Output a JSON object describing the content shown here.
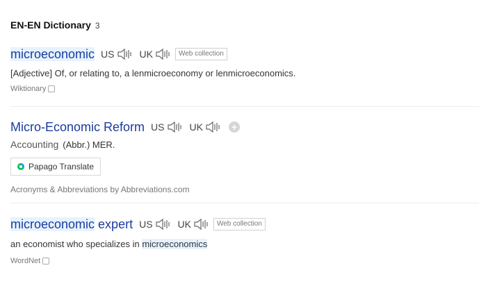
{
  "header": {
    "title": "EN-EN Dictionary",
    "count": "3"
  },
  "entries": [
    {
      "term": "microeconomic",
      "us_label": "US",
      "uk_label": "UK",
      "tag": "Web collection",
      "pos": "[Adjective]",
      "definition": " Of, or relating to, a lenmicroeconomy or lenmicroeconomics.",
      "source": "Wiktionary"
    },
    {
      "term": "Micro-Economic Reform",
      "us_label": "US",
      "uk_label": "UK",
      "category": "Accounting",
      "definition": "(Abbr.) MER.",
      "translate_button": "Papago Translate",
      "source": "Acronyms & Abbreviations by Abbreviations.com"
    },
    {
      "term_part1": "microeconomic",
      "term_part2": " expert",
      "us_label": "US",
      "uk_label": "UK",
      "tag": "Web collection",
      "definition_part1": "an economist who specializes in ",
      "definition_highlight": "microeconomics",
      "source": "WordNet"
    }
  ],
  "colors": {
    "term": "#1a3b9e",
    "highlight": "#e6f3ff",
    "papago_green": "#03c75a",
    "papago_blue": "#1e90ff"
  },
  "icons": {
    "speaker": "speaker-icon",
    "plus": "plus-icon",
    "copy": "copy-icon",
    "papago": "papago-icon"
  }
}
